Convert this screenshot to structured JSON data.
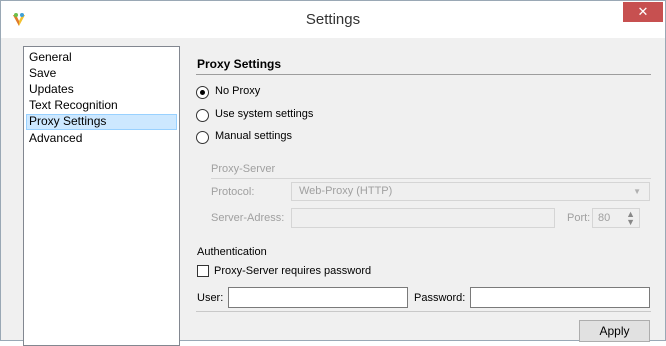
{
  "window": {
    "title": "Settings",
    "close_glyph": "✕"
  },
  "sidebar": {
    "items": [
      {
        "label": "General",
        "selected": false
      },
      {
        "label": "Save",
        "selected": false
      },
      {
        "label": "Updates",
        "selected": false
      },
      {
        "label": "Text Recognition",
        "selected": false
      },
      {
        "label": "Proxy Settings",
        "selected": true
      },
      {
        "label": "Advanced",
        "selected": false
      }
    ]
  },
  "proxy": {
    "section_title": "Proxy Settings",
    "options": [
      {
        "label": "No Proxy",
        "checked": true
      },
      {
        "label": "Use system settings",
        "checked": false
      },
      {
        "label": "Manual settings",
        "checked": false
      }
    ],
    "server_group_title": "Proxy-Server",
    "protocol_label": "Protocol:",
    "protocol_value": "Web-Proxy (HTTP)",
    "server_address_label": "Server-Adress:",
    "server_address_value": "",
    "port_label": "Port:",
    "port_value": "80"
  },
  "authentication": {
    "title": "Authentication",
    "requires_password_label": "Proxy-Server requires password",
    "requires_password_checked": false,
    "user_label": "User:",
    "user_value": "",
    "password_label": "Password:",
    "password_value": ""
  },
  "footer": {
    "apply_label": "Apply"
  },
  "colors": {
    "close_button": "#c75050",
    "selected_item_bg": "#cde8ff",
    "disabled_text": "#a0a0a0"
  }
}
